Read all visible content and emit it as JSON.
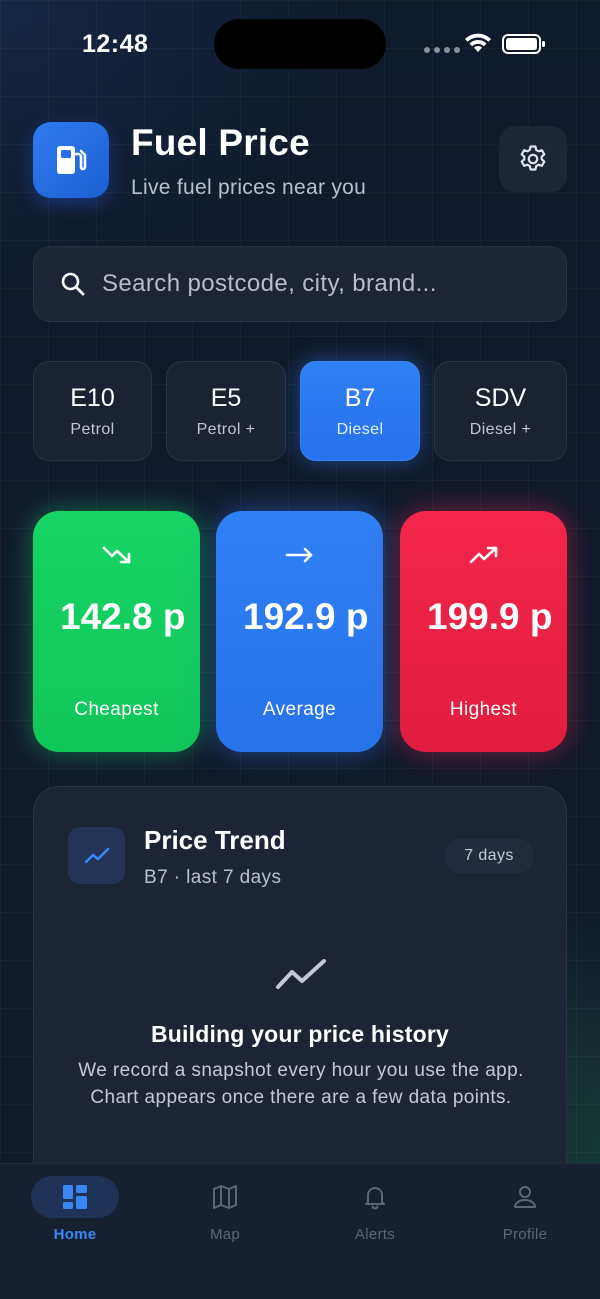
{
  "status_bar": {
    "time": "12:48"
  },
  "header": {
    "title": "Fuel Price",
    "subtitle": "Live fuel prices near you"
  },
  "search": {
    "placeholder": "Search postcode, city, brand..."
  },
  "fuel_tabs": [
    {
      "code": "E10",
      "name": "Petrol",
      "active": false
    },
    {
      "code": "E5",
      "name": "Petrol +",
      "active": false
    },
    {
      "code": "B7",
      "name": "Diesel",
      "active": true
    },
    {
      "code": "SDV",
      "name": "Diesel +",
      "active": false
    }
  ],
  "prices": [
    {
      "value": "142.8 p",
      "label": "Cheapest",
      "color": "#16d566",
      "icon": "trend-down-icon"
    },
    {
      "value": "192.9 p",
      "label": "Average",
      "color": "#2f80f5",
      "icon": "arrow-right-icon"
    },
    {
      "value": "199.9 p",
      "label": "Highest",
      "color": "#f2264a",
      "icon": "trend-up-icon"
    }
  ],
  "trend": {
    "title": "Price Trend",
    "subtitle": "B7 · last 7 days",
    "range": "7 days",
    "empty_title": "Building your price history",
    "empty_text": "We record a snapshot every hour you use the app.\nChart appears once there are a few data points."
  },
  "nav": [
    {
      "label": "Home",
      "icon": "dashboard-icon",
      "active": true
    },
    {
      "label": "Map",
      "icon": "map-icon",
      "active": false
    },
    {
      "label": "Alerts",
      "icon": "bell-icon",
      "active": false
    },
    {
      "label": "Profile",
      "icon": "user-icon",
      "active": false
    }
  ],
  "colors": {
    "accent": "#2f80f5",
    "green": "#16d566",
    "red": "#f2264a",
    "background": "#111a2c"
  }
}
